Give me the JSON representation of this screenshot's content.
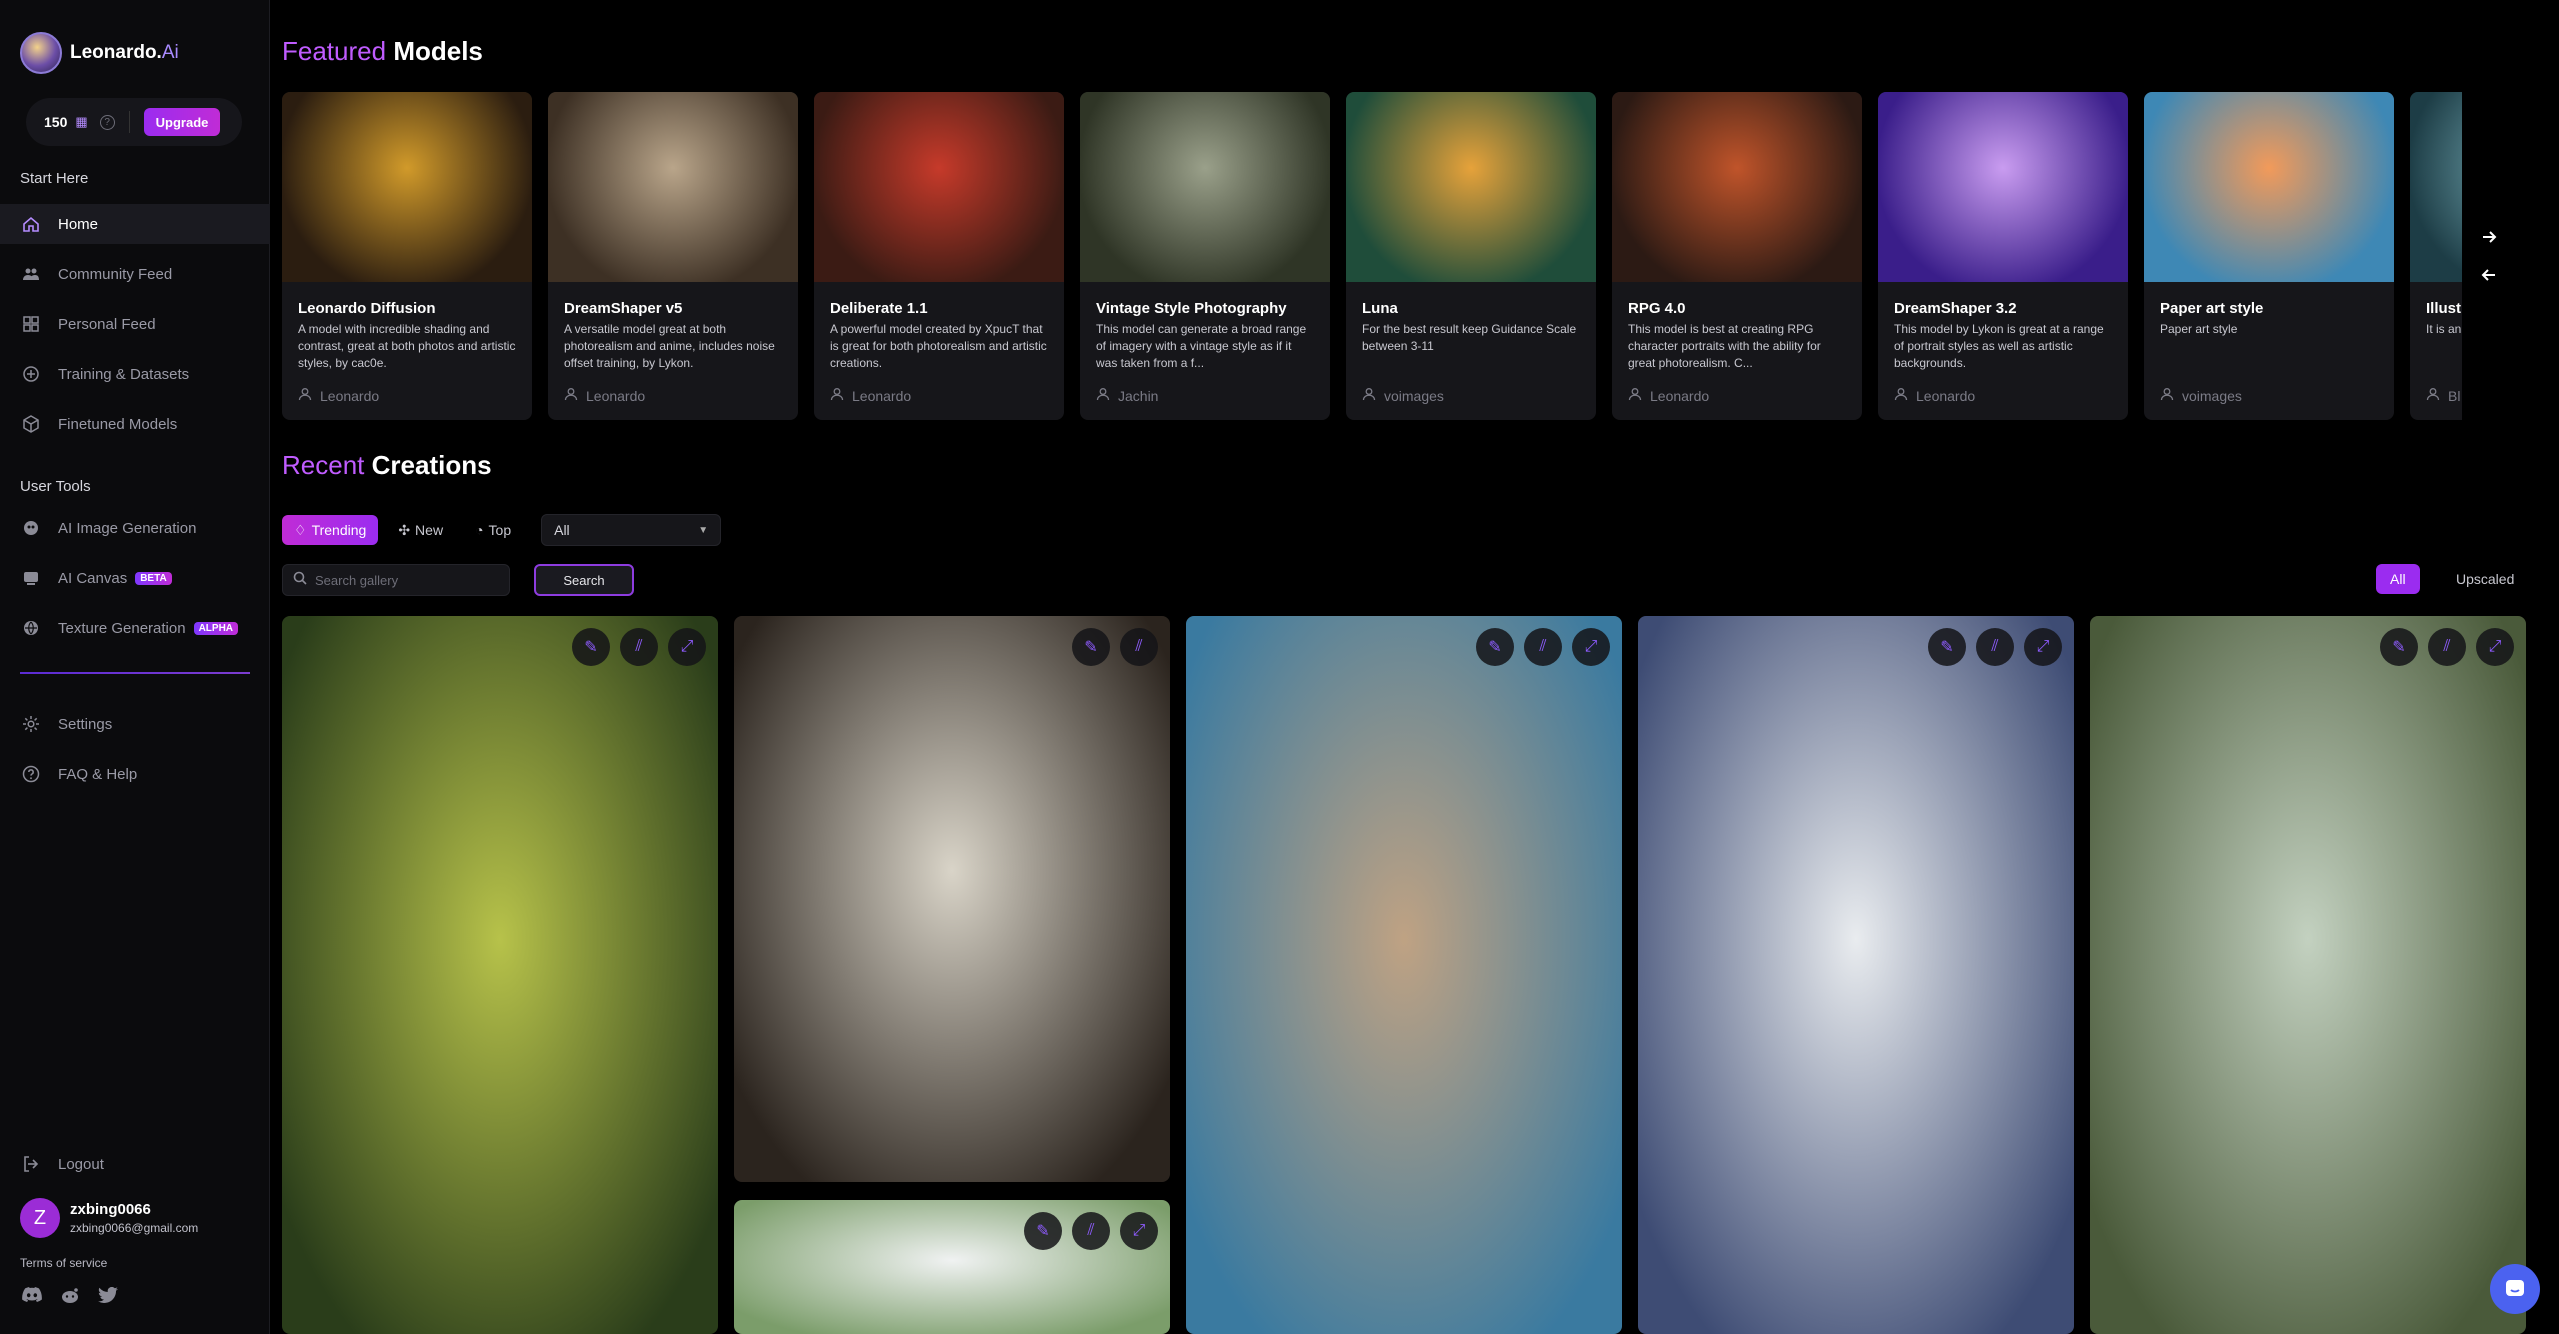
{
  "brand": {
    "name": "Leonardo.",
    "ai": "Ai"
  },
  "credits": {
    "amount": "150",
    "upgrade_label": "Upgrade"
  },
  "sidebar": {
    "start_here": "Start Here",
    "user_tools": "User Tools",
    "start_items": [
      {
        "label": "Home",
        "icon": "home-icon",
        "active": true
      },
      {
        "label": "Community Feed",
        "icon": "community-icon"
      },
      {
        "label": "Personal Feed",
        "icon": "grid-icon"
      },
      {
        "label": "Training & Datasets",
        "icon": "training-icon"
      },
      {
        "label": "Finetuned Models",
        "icon": "cube-icon"
      }
    ],
    "tool_items": [
      {
        "label": "AI Image Generation",
        "icon": "image-gen-icon"
      },
      {
        "label": "AI Canvas",
        "icon": "canvas-icon",
        "badge": "BETA"
      },
      {
        "label": "Texture Generation",
        "icon": "texture-icon",
        "badge": "ALPHA"
      }
    ],
    "bottom_items": [
      {
        "label": "Settings",
        "icon": "gear-icon"
      },
      {
        "label": "FAQ & Help",
        "icon": "help-icon"
      }
    ],
    "logout": "Logout",
    "user": {
      "initial": "Z",
      "name": "zxbing0066",
      "email": "zxbing0066@gmail.com"
    },
    "terms": "Terms of service"
  },
  "featured": {
    "title_accent": "Featured",
    "title_rest": "Models",
    "models": [
      {
        "name": "Leonardo Diffusion",
        "desc": "A model with incredible shading and contrast, great at both photos and artistic styles, by cac0e.",
        "author": "Leonardo",
        "c1": "#d19a2a",
        "c2": "#2b1d10"
      },
      {
        "name": "DreamShaper v5",
        "desc": "A versatile model great at both photorealism and anime, includes noise offset training, by Lykon.",
        "author": "Leonardo",
        "c1": "#b9a58a",
        "c2": "#3d3024"
      },
      {
        "name": "Deliberate 1.1",
        "desc": "A powerful model created by XpucT that is great for both photorealism and artistic creations.",
        "author": "Leonardo",
        "c1": "#c63a2a",
        "c2": "#3b1b14"
      },
      {
        "name": "Vintage Style Photography",
        "desc": "This model can generate a broad range of imagery with a vintage style as if it was taken from a f...",
        "author": "Jachin",
        "c1": "#9aa08a",
        "c2": "#2f3526"
      },
      {
        "name": "Luna",
        "desc": "For the best result keep Guidance Scale between 3-11",
        "author": "voimages",
        "c1": "#e6a23a",
        "c2": "#1f4d3a"
      },
      {
        "name": "RPG 4.0",
        "desc": "This model is best at creating RPG character portraits with the ability for great photorealism. C...",
        "author": "Leonardo",
        "c1": "#c0542a",
        "c2": "#2c1a14"
      },
      {
        "name": "DreamShaper 3.2",
        "desc": "This model by Lykon is great at a range of portrait styles as well as artistic backgrounds.",
        "author": "Leonardo",
        "c1": "#c99cf0",
        "c2": "#3a1e8a"
      },
      {
        "name": "Paper art style",
        "desc": "Paper art style",
        "author": "voimages",
        "c1": "#f29a5a",
        "c2": "#3e88b5"
      },
      {
        "name": "Illustra",
        "desc": "It is an illustra styles",
        "author": "Bl",
        "c1": "#7fb6c0",
        "c2": "#1d3d46"
      }
    ]
  },
  "recent": {
    "title_accent": "Recent",
    "title_rest": "Creations",
    "tabs": [
      "Trending",
      "New",
      "Top"
    ],
    "period": "All",
    "search_placeholder": "Search gallery",
    "search_button": "Search",
    "filter_all": "All",
    "filter_upscaled": "Upscaled"
  },
  "gallery": [
    {
      "c1": "#b7c24a",
      "c2": "#2a3d1a"
    },
    {
      "c1": "#d9d4c8",
      "c2": "#2b241e"
    },
    {
      "c1": "#bfa283",
      "c2": "#3a7aa0"
    },
    {
      "c1": "#e9ecef",
      "c2": "#3e4c74"
    },
    {
      "c1": "#c3d1c0",
      "c2": "#4a5a3a"
    },
    {
      "c1": "#f0f2f2",
      "c2": "#7b9d6a"
    }
  ]
}
